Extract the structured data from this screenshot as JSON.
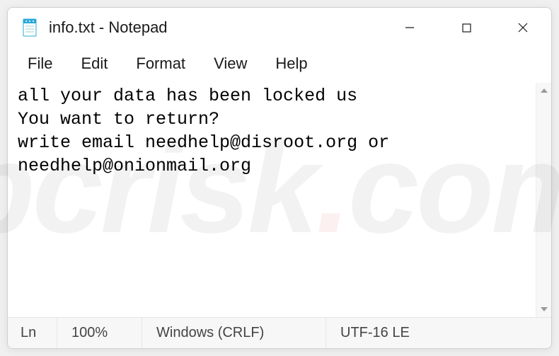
{
  "titlebar": {
    "icon_name": "notepad-icon",
    "title": "info.txt - Notepad"
  },
  "menubar": {
    "items": [
      {
        "label": "File"
      },
      {
        "label": "Edit"
      },
      {
        "label": "Format"
      },
      {
        "label": "View"
      },
      {
        "label": "Help"
      }
    ]
  },
  "editor": {
    "content": "all your data has been locked us\nYou want to return?\nwrite email needhelp@disroot.org or needhelp@onionmail.org"
  },
  "statusbar": {
    "line_label": "Ln",
    "zoom": "100%",
    "line_ending": "Windows (CRLF)",
    "encoding": "UTF-16 LE"
  },
  "watermark": {
    "text_left": "pcrisk",
    "text_dot": ".",
    "text_right": "com"
  }
}
